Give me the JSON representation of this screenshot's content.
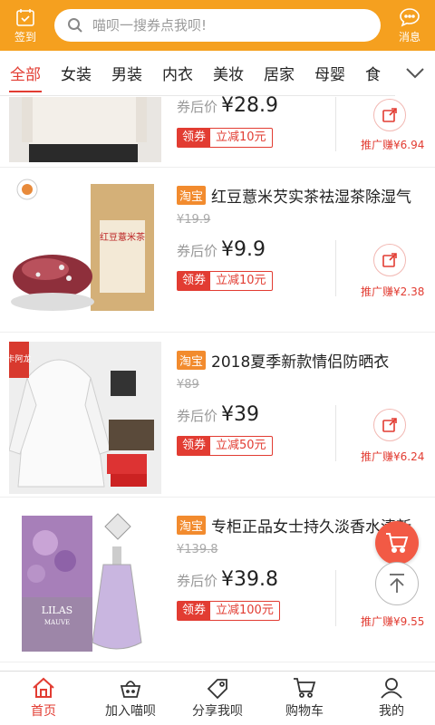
{
  "header": {
    "checkin_label": "签到",
    "search_placeholder": "喵呗一搜券点我呗!",
    "message_label": "消息"
  },
  "tabs": [
    "全部",
    "女装",
    "男装",
    "内衣",
    "美妆",
    "居家",
    "母婴",
    "食"
  ],
  "products": [
    {
      "after_label": "券后价",
      "price": "¥28.9",
      "coupon_tag": "领券",
      "coupon_value": "立减10元",
      "promo": "推广赚¥6.94"
    },
    {
      "tag": "淘宝",
      "title": "红豆薏米芡实茶祛湿茶除湿气",
      "original_price": "¥19.9",
      "after_label": "券后价",
      "price": "¥9.9",
      "coupon_tag": "领券",
      "coupon_value": "立减10元",
      "promo": "推广赚¥2.38",
      "package_text": "红豆薏米茶"
    },
    {
      "tag": "淘宝",
      "title": "2018夏季新款情侣防晒衣",
      "original_price": "¥89",
      "after_label": "券后价",
      "price": "¥39",
      "coupon_tag": "领券",
      "coupon_value": "立减50元",
      "promo": "推广赚¥6.24",
      "brand_badge": "卡阿龙"
    },
    {
      "tag": "淘宝",
      "title": "专柜正品女士持久淡香水清新",
      "original_price": "¥139.8",
      "after_label": "券后价",
      "price": "¥39.8",
      "coupon_tag": "领券",
      "coupon_value": "立减100元",
      "promo": "推广赚¥9.55",
      "box_text": "LILAS",
      "box_sub": "MAUVE"
    }
  ],
  "bottom_nav": [
    {
      "label": "首页",
      "icon": "home-icon"
    },
    {
      "label": "加入喵呗",
      "icon": "basket-icon"
    },
    {
      "label": "分享我呗",
      "icon": "tag-icon"
    },
    {
      "label": "购物车",
      "icon": "cart-icon"
    },
    {
      "label": "我的",
      "icon": "user-icon"
    }
  ],
  "colors": {
    "brand": "#f5a01f",
    "accent": "#e23c32"
  }
}
